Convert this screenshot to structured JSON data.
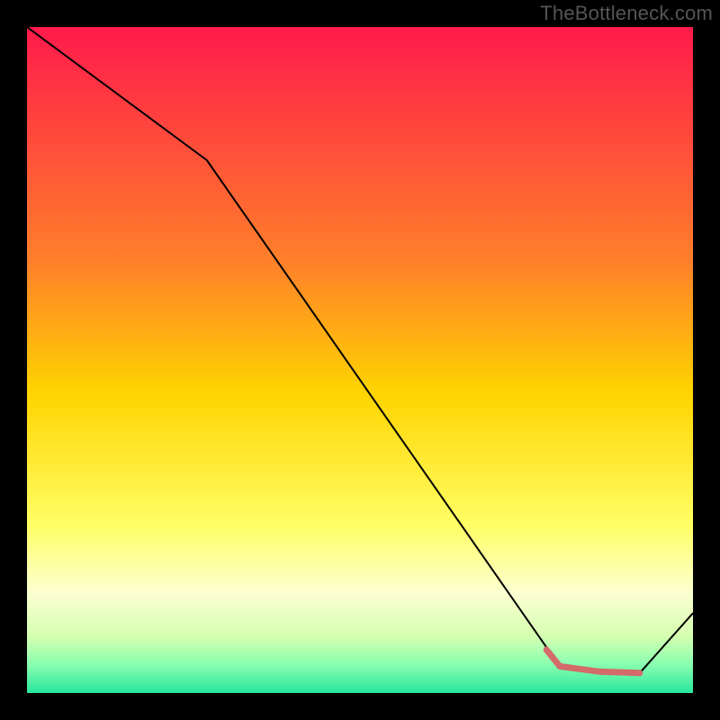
{
  "watermark": "TheBottleneck.com",
  "chart_data": {
    "type": "line",
    "title": "",
    "xlabel": "",
    "ylabel": "",
    "xlim": [
      0,
      100
    ],
    "ylim": [
      0,
      100
    ],
    "grid": false,
    "legend": false,
    "line_color": "#000000",
    "line_width": 2,
    "background": "vertical_gradient",
    "gradient_stops": [
      {
        "offset": 0.0,
        "color": "#ff1a4b"
      },
      {
        "offset": 0.35,
        "color": "#ff7f2a"
      },
      {
        "offset": 0.55,
        "color": "#ffd400"
      },
      {
        "offset": 0.75,
        "color": "#ffff66"
      },
      {
        "offset": 0.85,
        "color": "#fcffd1"
      },
      {
        "offset": 0.915,
        "color": "#d4ffb0"
      },
      {
        "offset": 0.955,
        "color": "#8dffb0"
      },
      {
        "offset": 1.0,
        "color": "#28e69e"
      }
    ],
    "x": [
      0,
      27,
      80,
      92,
      100
    ],
    "values": [
      100,
      80,
      4,
      3,
      12
    ],
    "highlight_segment": {
      "color": "#d46a6a",
      "width": 7,
      "x": [
        78,
        80,
        86,
        92
      ],
      "values": [
        6.5,
        4,
        3.2,
        3
      ]
    }
  }
}
